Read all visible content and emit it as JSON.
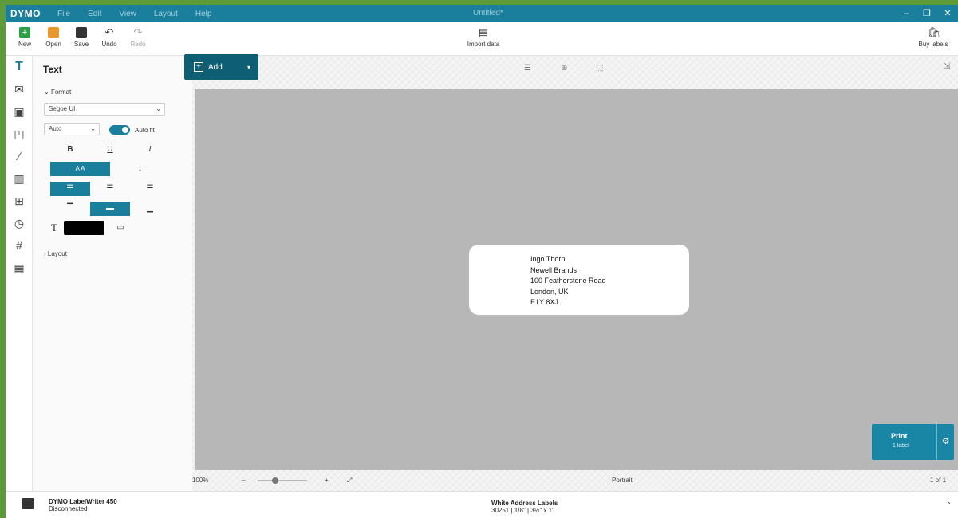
{
  "app": {
    "logo": "DYMO",
    "doc_title": "Untitled*"
  },
  "menu": [
    "File",
    "Edit",
    "View",
    "Layout",
    "Help"
  ],
  "window_controls": {
    "minimize": "–",
    "restore": "❐",
    "close": "✕"
  },
  "toolbar": {
    "new": "New",
    "open": "Open",
    "save": "Save",
    "undo": "Undo",
    "redo": "Redo",
    "import": "Import data",
    "buy": "Buy labels"
  },
  "rail_icons": [
    "text-icon",
    "address-icon",
    "image-icon",
    "shapes-icon",
    "line-icon",
    "barcode-icon",
    "qr-code-icon",
    "date-time-icon",
    "counter-icon",
    "table-icon"
  ],
  "panel": {
    "title": "Text",
    "format_section": "Format",
    "font": "Segoe UI",
    "size": "Auto",
    "auto_fit_label": "Auto fit",
    "bold": "B",
    "underline": "U",
    "italic": "I",
    "size_button": "A A",
    "layout_section": "Layout"
  },
  "add_button": {
    "label": "Add"
  },
  "canvas_tools": {
    "align": "☰",
    "distribute": "⊕",
    "size": "⬚"
  },
  "label_text": [
    "Ingo Thorn",
    "Newell Brands",
    "100 Featherstone Road",
    "London, UK",
    "E1Y 8XJ"
  ],
  "print_button": {
    "title": "Print",
    "subtitle": "1 label"
  },
  "zoom": {
    "value": "100%",
    "minus": "–",
    "plus": "+",
    "fit": "⤢",
    "orientation": "Portrait",
    "page": "1 of 1"
  },
  "status": {
    "printer_name": "DYMO LabelWriter 450",
    "printer_state": "Disconnected",
    "label_name": "White Address Labels",
    "label_size": "30251 | 1/8\" | 3½\" x 1\""
  }
}
